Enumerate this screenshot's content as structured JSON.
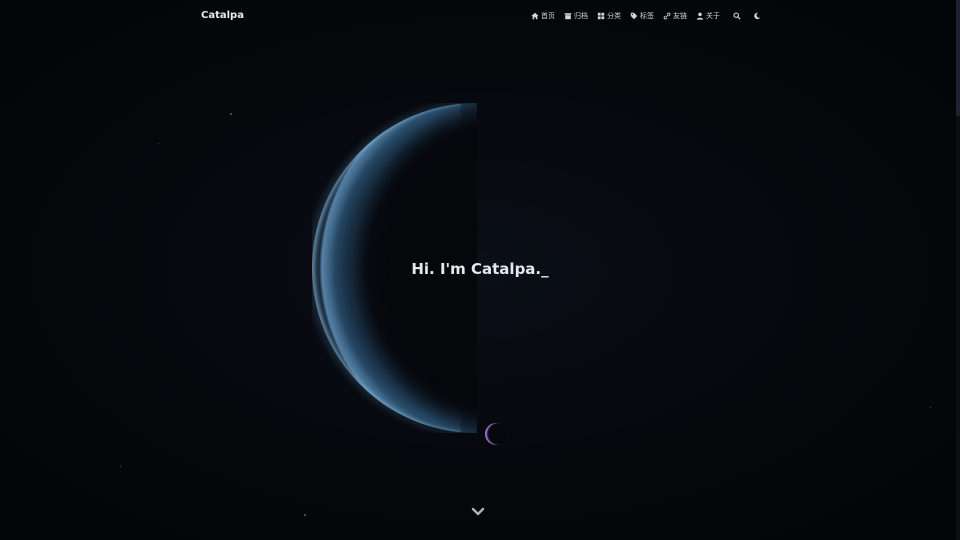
{
  "brand": {
    "name": "Catalpa"
  },
  "nav": {
    "items": [
      {
        "icon": "home-icon",
        "label": "首页"
      },
      {
        "icon": "archive-icon",
        "label": "归档"
      },
      {
        "icon": "category-icon",
        "label": "分类"
      },
      {
        "icon": "tag-icon",
        "label": "标签"
      },
      {
        "icon": "link-icon",
        "label": "友链"
      },
      {
        "icon": "user-icon",
        "label": "关于"
      }
    ],
    "search_icon": "search-icon",
    "theme_icon": "moon-icon"
  },
  "hero": {
    "text": "Hi. I'm Catalpa._"
  },
  "scroll_icon": "chevron-down-icon",
  "colors": {
    "background": "#05070b",
    "planet_rim": "#5f8caf",
    "moon_rim": "#aa78e6",
    "text": "#e4e8ee"
  }
}
